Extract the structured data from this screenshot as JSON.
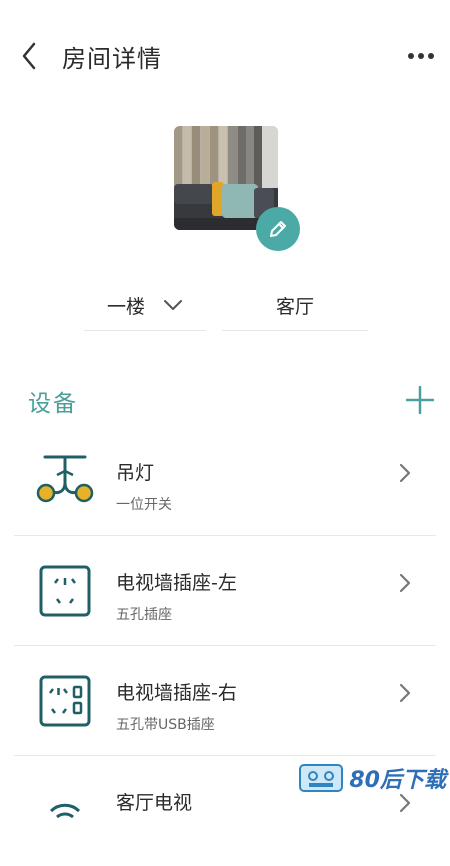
{
  "header": {
    "title": "房间详情",
    "back_icon": "chevron-left-icon",
    "more_icon": "more-horizontal-icon"
  },
  "room": {
    "photo_icon": "room-photo",
    "edit_icon": "pencil-icon",
    "floor": "一楼",
    "floor_icon": "chevron-down-icon",
    "name": "客厅"
  },
  "devices_section": {
    "title": "设备",
    "add_icon": "plus-icon"
  },
  "devices": [
    {
      "name": "吊灯",
      "type": "一位开关",
      "icon": "pendant-lamp-icon"
    },
    {
      "name": "电视墙插座-左",
      "type": "五孔插座",
      "icon": "five-hole-socket-icon"
    },
    {
      "name": "电视墙插座-右",
      "type": "五孔带USB插座",
      "icon": "usb-socket-icon"
    },
    {
      "name": "客厅电视",
      "type": "",
      "icon": "wifi-icon"
    }
  ],
  "watermark": {
    "text": "80后下载"
  },
  "colors": {
    "accent": "#4a9f9b",
    "edit_button": "#4caaa6",
    "lamp_yellow": "#e8b228",
    "icon_dark": "#1f5f66"
  }
}
